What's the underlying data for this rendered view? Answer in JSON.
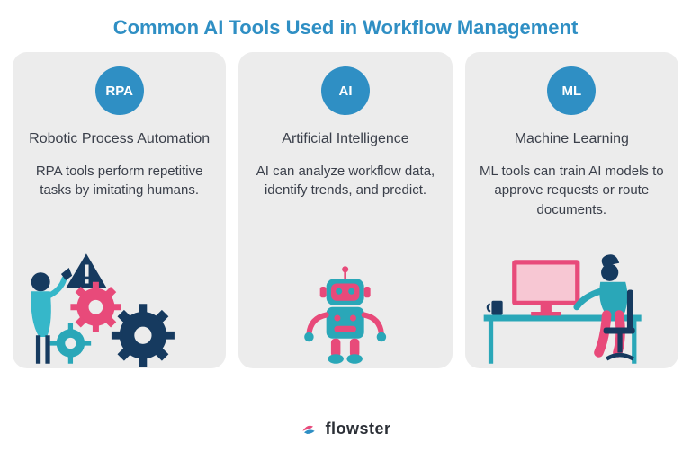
{
  "title": "Common AI Tools Used in Workflow Management",
  "cards": [
    {
      "badge": "RPA",
      "heading": "Robotic Process Automation",
      "desc": "RPA tools perform repetitive tasks by imitating humans."
    },
    {
      "badge": "AI",
      "heading": "Artificial Intelligence",
      "desc": "AI can analyze workflow data, identify trends, and predict."
    },
    {
      "badge": "ML",
      "heading": "Machine Learning",
      "desc": "ML tools can train AI models to approve requests or route documents."
    }
  ],
  "footer": {
    "brand": "flowster"
  },
  "colors": {
    "accent": "#2f8fc4",
    "pink": "#e84a7a",
    "teal": "#2aa7b8",
    "navy": "#163a5f",
    "panel": "#ececec"
  }
}
